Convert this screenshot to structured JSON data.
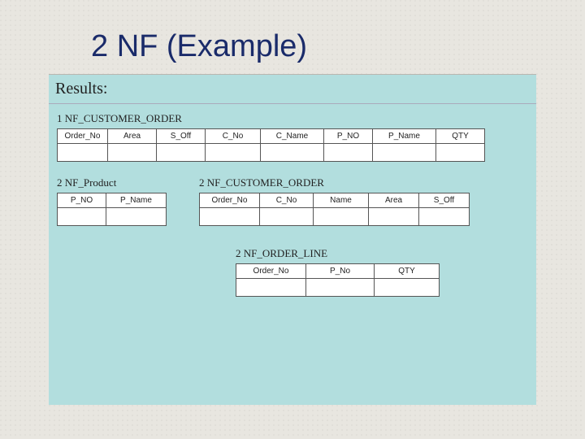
{
  "title": "2 NF (Example)",
  "subtitle": "Results:",
  "tables": {
    "t1": {
      "name": "1 NF_CUSTOMER_ORDER",
      "cols": [
        "Order_No",
        "Area",
        "S_Off",
        "C_No",
        "C_Name",
        "P_NO",
        "P_Name",
        "QTY"
      ]
    },
    "t2": {
      "name": "2 NF_Product",
      "cols": [
        "P_NO",
        "P_Name"
      ]
    },
    "t3": {
      "name": "2 NF_CUSTOMER_ORDER",
      "cols": [
        "Order_No",
        "C_No",
        "Name",
        "Area",
        "S_Off"
      ]
    },
    "t4": {
      "name": "2 NF_ORDER_LINE",
      "cols": [
        "Order_No",
        "P_No",
        "QTY"
      ]
    }
  }
}
